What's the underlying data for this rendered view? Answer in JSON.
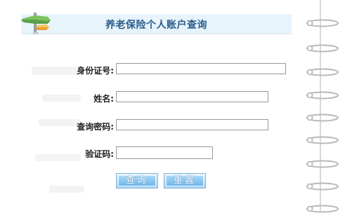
{
  "header": {
    "title": "养老保险个人账户查询"
  },
  "form": {
    "id_label": "身份证号:",
    "name_label": "姓名:",
    "password_label": "查询密码:",
    "captcha_label": "验证码:",
    "id_value": "",
    "name_value": "",
    "password_value": "",
    "captcha_value": ""
  },
  "buttons": {
    "query_label": "查询",
    "reset_label": "重置"
  },
  "icons": {
    "header": "signpost-icon",
    "binder": "notebook-ring-icon"
  },
  "colors": {
    "title": "#2a5c8a",
    "header_band": "#e8f4fb",
    "button": "#7fb4da"
  }
}
